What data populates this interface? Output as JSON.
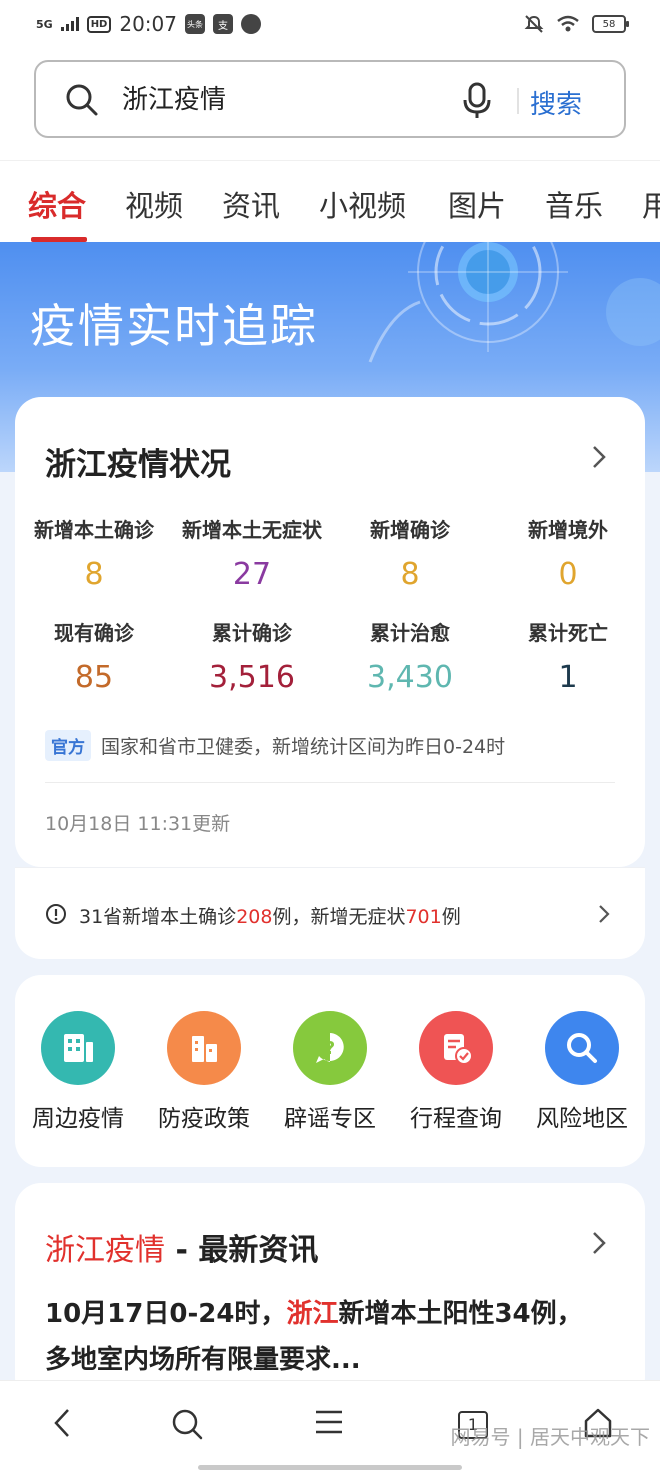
{
  "status_bar": {
    "network": "5G",
    "hd": "HD",
    "time": "20:07",
    "app_badge_1": "头条",
    "app_badge_2": "支",
    "battery": "58"
  },
  "search": {
    "query": "浙江疫情",
    "button": "搜索"
  },
  "tabs": [
    "综合",
    "视频",
    "资讯",
    "小视频",
    "图片",
    "音乐",
    "用"
  ],
  "hero": {
    "title": "疫情实时追踪"
  },
  "status_card": {
    "title": "浙江疫情状况",
    "stats": [
      {
        "label": "新增本土确诊",
        "value": "8",
        "color": "#e0a52e"
      },
      {
        "label": "新增本土无症状",
        "value": "27",
        "color": "#8a3aa0"
      },
      {
        "label": "新增确诊",
        "value": "8",
        "color": "#e0a52e"
      },
      {
        "label": "新增境外",
        "value": "0",
        "color": "#e0a52e"
      },
      {
        "label": "现有确诊",
        "value": "85",
        "color": "#c36a2a"
      },
      {
        "label": "累计确诊",
        "value": "3,516",
        "color": "#a3203a"
      },
      {
        "label": "累计治愈",
        "value": "3,430",
        "color": "#5fb7b0"
      },
      {
        "label": "累计死亡",
        "value": "1",
        "color": "#1d3a4d"
      }
    ],
    "official_badge": "官方",
    "official_text": "国家和省市卫健委，新增统计区间为昨日0-24时",
    "update_time": "10月18日 11:31更新"
  },
  "notice": {
    "prefix": "31省新增本土确诊",
    "num1": "208",
    "mid": "例，新增无症状",
    "num2": "701",
    "suffix": "例"
  },
  "services": [
    {
      "label": "周边疫情",
      "color": "#34b8b0",
      "icon": "building-icon"
    },
    {
      "label": "防疫政策",
      "color": "#f58a4a",
      "icon": "policy-icon"
    },
    {
      "label": "辟谣专区",
      "color": "#86c93d",
      "icon": "question-icon"
    },
    {
      "label": "行程查询",
      "color": "#ef5454",
      "icon": "itinerary-icon"
    },
    {
      "label": "风险地区",
      "color": "#3e86ee",
      "icon": "search-icon"
    }
  ],
  "news": {
    "title_red": "浙江疫情",
    "title_rest": " - 最新资讯",
    "body_1": "10月17日0-24时，",
    "body_red": "浙江",
    "body_2": "新增本土阳性34例，多地室内场所有限量要求..."
  },
  "bottom_nav": {
    "tabs_count": "1"
  },
  "watermark": "网易号 | 居天中观天下"
}
